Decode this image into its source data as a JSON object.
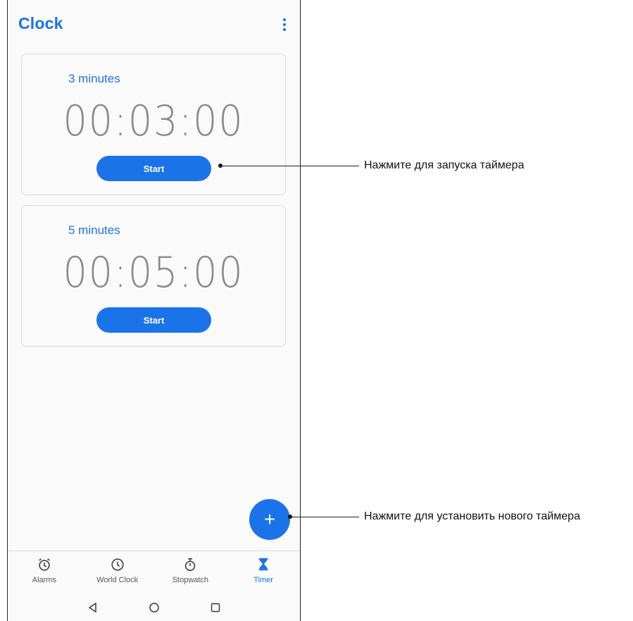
{
  "app": {
    "title": "Clock"
  },
  "colors": {
    "accent": "#1a73e8",
    "time_text": "#8a8a8a",
    "icon": "#444444"
  },
  "timers": [
    {
      "label": "3 minutes",
      "time": "00:03:00",
      "button": "Start"
    },
    {
      "label": "5 minutes",
      "time": "00:05:00",
      "button": "Start"
    }
  ],
  "fab": {
    "icon": "plus-icon",
    "symbol": "+"
  },
  "bottom_nav": [
    {
      "label": "Alarms",
      "icon": "alarm-icon"
    },
    {
      "label": "World Clock",
      "icon": "clock-icon"
    },
    {
      "label": "Stopwatch",
      "icon": "stopwatch-icon"
    },
    {
      "label": "Timer",
      "icon": "hourglass-icon",
      "active": true
    }
  ],
  "system_nav": [
    "back-icon",
    "home-icon",
    "recents-icon"
  ],
  "callouts": {
    "start": "Нажмите для запуска таймера",
    "add": "Нажмите для установить нового таймера"
  }
}
